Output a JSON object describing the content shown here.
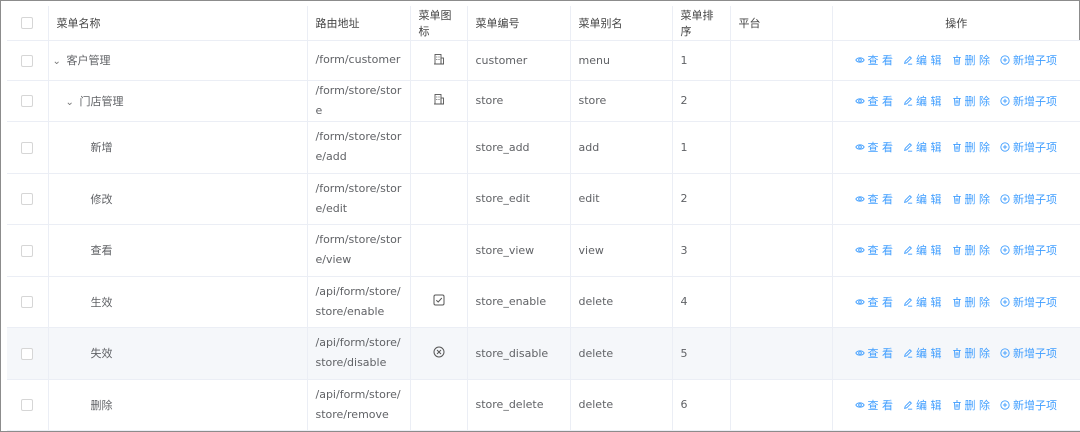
{
  "columns": {
    "name": "菜单名称",
    "path": "路由地址",
    "icon": "菜单图标",
    "code": "菜单编号",
    "alias": "菜单别名",
    "sort": "菜单排序",
    "platform": "平台",
    "ops": "操作"
  },
  "actions": {
    "view": "查 看",
    "edit": "编 辑",
    "delete": "删 除",
    "add_child": "新增子项"
  },
  "colors": {
    "accent": "#409eff",
    "text": "#606266",
    "border": "#ebeef5"
  },
  "rows": [
    {
      "name": "客户管理",
      "expandable": true,
      "path": "/form/customer",
      "icon": "building-icon",
      "code": "customer",
      "alias": "menu",
      "sort": "1",
      "platform": ""
    },
    {
      "name": "门店管理",
      "expandable": true,
      "path": "/form/store/store",
      "icon": "building-icon",
      "code": "store",
      "alias": "store",
      "sort": "2",
      "platform": ""
    },
    {
      "name": "新增",
      "expandable": false,
      "path": "/form/store/store/add",
      "icon": "",
      "code": "store_add",
      "alias": "add",
      "sort": "1",
      "platform": ""
    },
    {
      "name": "修改",
      "expandable": false,
      "path": "/form/store/store/edit",
      "icon": "",
      "code": "store_edit",
      "alias": "edit",
      "sort": "2",
      "platform": ""
    },
    {
      "name": "查看",
      "expandable": false,
      "path": "/form/store/store/view",
      "icon": "",
      "code": "store_view",
      "alias": "view",
      "sort": "3",
      "platform": ""
    },
    {
      "name": "生效",
      "expandable": false,
      "path": "/api/form/store/store/enable",
      "icon": "check-square-icon",
      "code": "store_enable",
      "alias": "delete",
      "sort": "4",
      "platform": ""
    },
    {
      "name": "失效",
      "expandable": false,
      "path": "/api/form/store/store/disable",
      "icon": "circle-x-icon",
      "code": "store_disable",
      "alias": "delete",
      "sort": "5",
      "platform": ""
    },
    {
      "name": "删除",
      "expandable": false,
      "path": "/api/form/store/store/remove",
      "icon": "",
      "code": "store_delete",
      "alias": "delete",
      "sort": "6",
      "platform": ""
    }
  ]
}
